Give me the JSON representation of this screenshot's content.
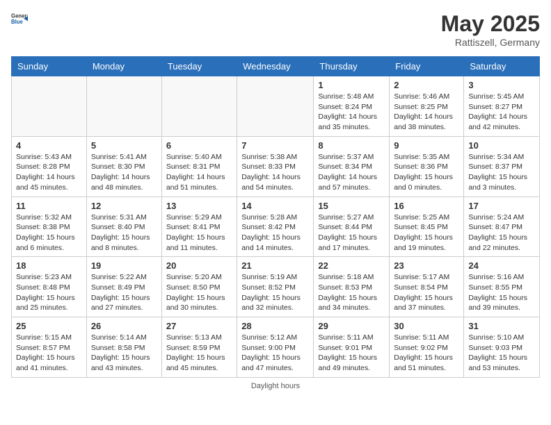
{
  "logo": {
    "general": "General",
    "blue": "Blue"
  },
  "title": "May 2025",
  "location": "Rattiszell, Germany",
  "days_of_week": [
    "Sunday",
    "Monday",
    "Tuesday",
    "Wednesday",
    "Thursday",
    "Friday",
    "Saturday"
  ],
  "footer": "Daylight hours",
  "weeks": [
    [
      {
        "day": "",
        "info": ""
      },
      {
        "day": "",
        "info": ""
      },
      {
        "day": "",
        "info": ""
      },
      {
        "day": "",
        "info": ""
      },
      {
        "day": "1",
        "info": "Sunrise: 5:48 AM\nSunset: 8:24 PM\nDaylight: 14 hours\nand 35 minutes."
      },
      {
        "day": "2",
        "info": "Sunrise: 5:46 AM\nSunset: 8:25 PM\nDaylight: 14 hours\nand 38 minutes."
      },
      {
        "day": "3",
        "info": "Sunrise: 5:45 AM\nSunset: 8:27 PM\nDaylight: 14 hours\nand 42 minutes."
      }
    ],
    [
      {
        "day": "4",
        "info": "Sunrise: 5:43 AM\nSunset: 8:28 PM\nDaylight: 14 hours\nand 45 minutes."
      },
      {
        "day": "5",
        "info": "Sunrise: 5:41 AM\nSunset: 8:30 PM\nDaylight: 14 hours\nand 48 minutes."
      },
      {
        "day": "6",
        "info": "Sunrise: 5:40 AM\nSunset: 8:31 PM\nDaylight: 14 hours\nand 51 minutes."
      },
      {
        "day": "7",
        "info": "Sunrise: 5:38 AM\nSunset: 8:33 PM\nDaylight: 14 hours\nand 54 minutes."
      },
      {
        "day": "8",
        "info": "Sunrise: 5:37 AM\nSunset: 8:34 PM\nDaylight: 14 hours\nand 57 minutes."
      },
      {
        "day": "9",
        "info": "Sunrise: 5:35 AM\nSunset: 8:36 PM\nDaylight: 15 hours\nand 0 minutes."
      },
      {
        "day": "10",
        "info": "Sunrise: 5:34 AM\nSunset: 8:37 PM\nDaylight: 15 hours\nand 3 minutes."
      }
    ],
    [
      {
        "day": "11",
        "info": "Sunrise: 5:32 AM\nSunset: 8:38 PM\nDaylight: 15 hours\nand 6 minutes."
      },
      {
        "day": "12",
        "info": "Sunrise: 5:31 AM\nSunset: 8:40 PM\nDaylight: 15 hours\nand 8 minutes."
      },
      {
        "day": "13",
        "info": "Sunrise: 5:29 AM\nSunset: 8:41 PM\nDaylight: 15 hours\nand 11 minutes."
      },
      {
        "day": "14",
        "info": "Sunrise: 5:28 AM\nSunset: 8:42 PM\nDaylight: 15 hours\nand 14 minutes."
      },
      {
        "day": "15",
        "info": "Sunrise: 5:27 AM\nSunset: 8:44 PM\nDaylight: 15 hours\nand 17 minutes."
      },
      {
        "day": "16",
        "info": "Sunrise: 5:25 AM\nSunset: 8:45 PM\nDaylight: 15 hours\nand 19 minutes."
      },
      {
        "day": "17",
        "info": "Sunrise: 5:24 AM\nSunset: 8:47 PM\nDaylight: 15 hours\nand 22 minutes."
      }
    ],
    [
      {
        "day": "18",
        "info": "Sunrise: 5:23 AM\nSunset: 8:48 PM\nDaylight: 15 hours\nand 25 minutes."
      },
      {
        "day": "19",
        "info": "Sunrise: 5:22 AM\nSunset: 8:49 PM\nDaylight: 15 hours\nand 27 minutes."
      },
      {
        "day": "20",
        "info": "Sunrise: 5:20 AM\nSunset: 8:50 PM\nDaylight: 15 hours\nand 30 minutes."
      },
      {
        "day": "21",
        "info": "Sunrise: 5:19 AM\nSunset: 8:52 PM\nDaylight: 15 hours\nand 32 minutes."
      },
      {
        "day": "22",
        "info": "Sunrise: 5:18 AM\nSunset: 8:53 PM\nDaylight: 15 hours\nand 34 minutes."
      },
      {
        "day": "23",
        "info": "Sunrise: 5:17 AM\nSunset: 8:54 PM\nDaylight: 15 hours\nand 37 minutes."
      },
      {
        "day": "24",
        "info": "Sunrise: 5:16 AM\nSunset: 8:55 PM\nDaylight: 15 hours\nand 39 minutes."
      }
    ],
    [
      {
        "day": "25",
        "info": "Sunrise: 5:15 AM\nSunset: 8:57 PM\nDaylight: 15 hours\nand 41 minutes."
      },
      {
        "day": "26",
        "info": "Sunrise: 5:14 AM\nSunset: 8:58 PM\nDaylight: 15 hours\nand 43 minutes."
      },
      {
        "day": "27",
        "info": "Sunrise: 5:13 AM\nSunset: 8:59 PM\nDaylight: 15 hours\nand 45 minutes."
      },
      {
        "day": "28",
        "info": "Sunrise: 5:12 AM\nSunset: 9:00 PM\nDaylight: 15 hours\nand 47 minutes."
      },
      {
        "day": "29",
        "info": "Sunrise: 5:11 AM\nSunset: 9:01 PM\nDaylight: 15 hours\nand 49 minutes."
      },
      {
        "day": "30",
        "info": "Sunrise: 5:11 AM\nSunset: 9:02 PM\nDaylight: 15 hours\nand 51 minutes."
      },
      {
        "day": "31",
        "info": "Sunrise: 5:10 AM\nSunset: 9:03 PM\nDaylight: 15 hours\nand 53 minutes."
      }
    ]
  ]
}
